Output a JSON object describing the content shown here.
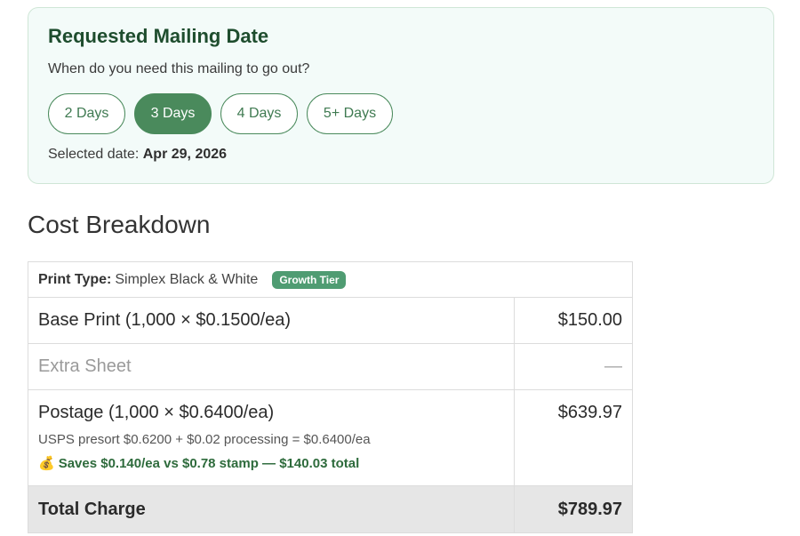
{
  "mailing": {
    "title": "Requested Mailing Date",
    "question": "When do you need this mailing to go out?",
    "options": [
      {
        "label": "2 Days",
        "selected": false
      },
      {
        "label": "3 Days",
        "selected": true
      },
      {
        "label": "4 Days",
        "selected": false
      },
      {
        "label": "5+ Days",
        "selected": false
      }
    ],
    "selected_label": "Selected date:",
    "selected_value": "Apr 29, 2026"
  },
  "cost": {
    "heading": "Cost Breakdown",
    "print_type_label": "Print Type:",
    "print_type_value": "Simplex Black & White",
    "tier_badge": "Growth Tier",
    "base_print": {
      "label": "Base Print (1,000 × $0.1500/ea)",
      "amount": "$150.00"
    },
    "extra_sheet": {
      "label": "Extra Sheet",
      "amount": "—"
    },
    "postage": {
      "label": "Postage (1,000 × $0.6400/ea)",
      "amount": "$639.97",
      "detail": "USPS presort $0.6200 + $0.02 processing = $0.6400/ea",
      "savings_icon": "money-bag-icon",
      "savings": "Saves $0.140/ea vs $0.78 stamp — $140.03 total"
    },
    "total": {
      "label": "Total Charge",
      "amount": "$789.97"
    }
  },
  "colors": {
    "accent": "#4a8a5c",
    "card_bg": "#f3fbf9",
    "badge": "#4f9c72",
    "total_bg": "#e6e6e6"
  }
}
